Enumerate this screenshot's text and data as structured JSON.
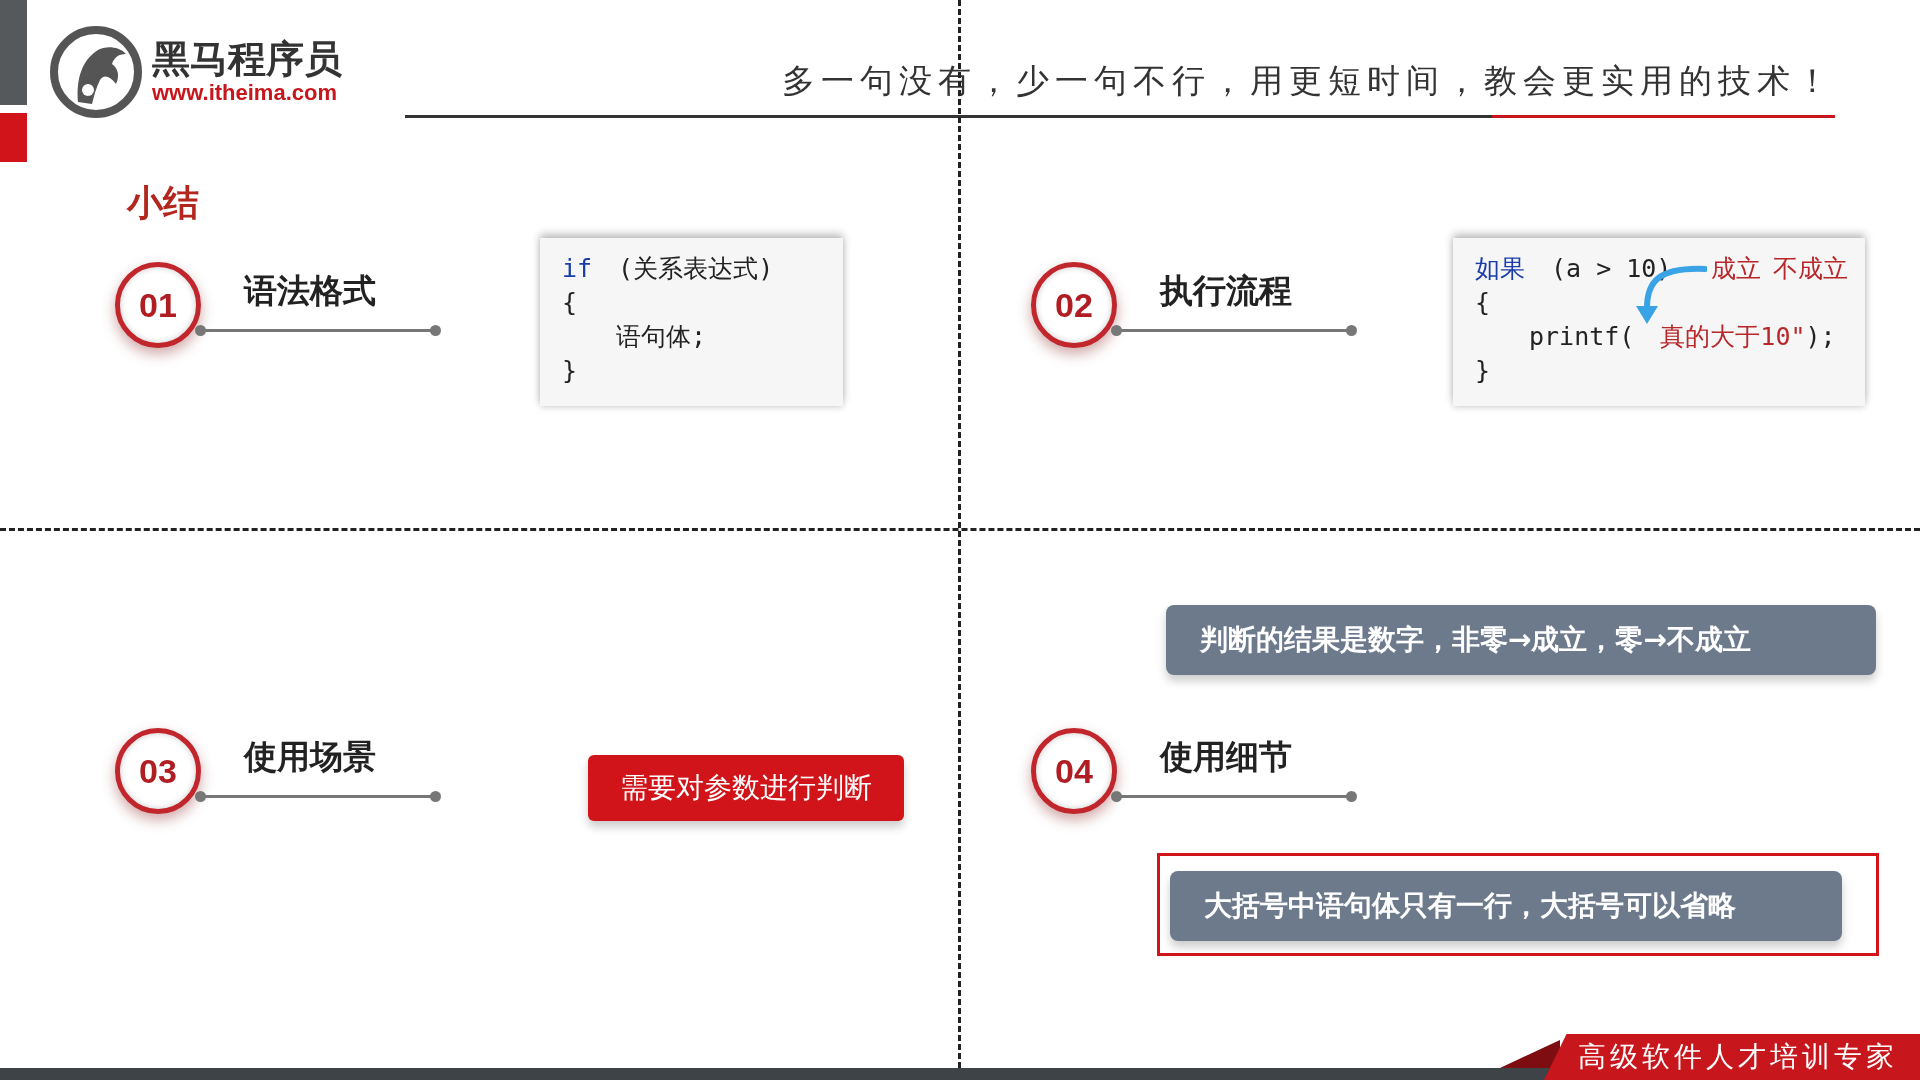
{
  "logo": {
    "name": "黑马程序员",
    "url": "www.itheima.com"
  },
  "slogan": "多一句没有，少一句不行，用更短时间，教会更实用的技术！",
  "title": "小结",
  "sections": [
    {
      "number": "01",
      "label": "语法格式",
      "details": [
        {
          "kind": "code",
          "lines": [
            {
              "indented": false,
              "tokens": [
                {
                  "kind": "keyword",
                  "text": "if"
                },
                {
                  "kind": "plain",
                  "text": "(关系表达式)"
                }
              ]
            },
            {
              "indented": false,
              "tokens": [
                {
                  "kind": "plain",
                  "text": "{"
                }
              ]
            },
            {
              "indented": true,
              "tokens": [
                {
                  "kind": "plain",
                  "text": "语句体;"
                }
              ]
            },
            {
              "indented": false,
              "tokens": [
                {
                  "kind": "plain",
                  "text": "}"
                }
              ]
            }
          ]
        }
      ]
    },
    {
      "number": "02",
      "label": "执行流程",
      "details": [
        {
          "kind": "code",
          "lines": [
            {
              "indented": false,
              "tokens": [
                {
                  "kind": "keyword",
                  "text": "如果"
                },
                {
                  "kind": "plain",
                  "text": "(a > 10)"
                }
              ],
              "annotations": [
                "成立",
                "不成立"
              ]
            },
            {
              "indented": false,
              "tokens": [
                {
                  "kind": "plain",
                  "text": "{"
                }
              ]
            },
            {
              "indented": true,
              "tokens": [
                {
                  "kind": "plain",
                  "text": "printf("
                },
                {
                  "kind": "string",
                  "text": "真的大于10\""
                },
                {
                  "kind": "plain",
                  "text": ");"
                }
              ]
            },
            {
              "indented": false,
              "tokens": [
                {
                  "kind": "plain",
                  "text": "}"
                }
              ]
            }
          ],
          "arrow": true
        }
      ]
    },
    {
      "number": "03",
      "label": "使用场景",
      "details": [
        {
          "kind": "tag",
          "text": "需要对参数进行判断"
        }
      ]
    },
    {
      "number": "04",
      "label": "使用细节"
    }
  ],
  "notes": [
    {
      "text": "判断的结果是数字，非零→成立，零→不成立",
      "highlighted": false
    },
    {
      "text": "大括号中语句体只有一行，大括号可以省略",
      "highlighted": true
    }
  ],
  "footer": "高级软件人才培训专家"
}
